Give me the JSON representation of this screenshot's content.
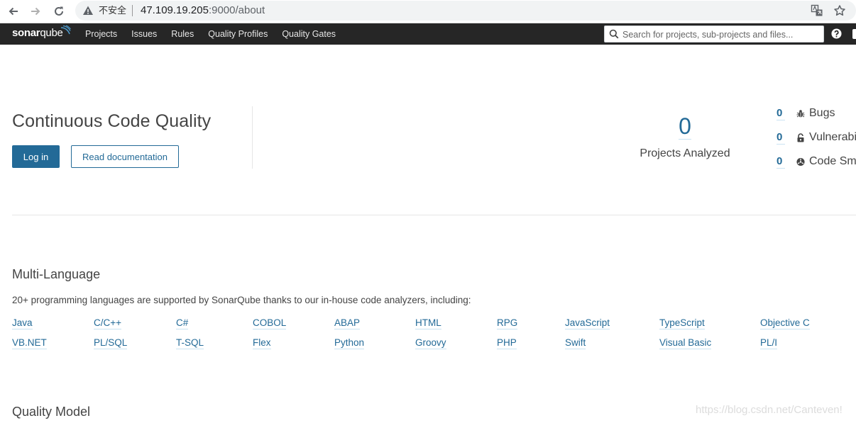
{
  "browser": {
    "security_label": "不安全",
    "url_host": "47.109.19.205",
    "url_path": ":9000/about"
  },
  "nav": {
    "logo_sonar": "sonar",
    "logo_qube": "qube",
    "links": [
      "Projects",
      "Issues",
      "Rules",
      "Quality Profiles",
      "Quality Gates"
    ],
    "search_placeholder": "Search for projects, sub-projects and files..."
  },
  "hero": {
    "title": "Continuous Code Quality",
    "login_label": "Log in",
    "docs_label": "Read documentation",
    "projects_count": "0",
    "projects_label": "Projects Analyzed",
    "metrics": [
      {
        "value": "0",
        "label": "Bugs",
        "icon": "bug-icon"
      },
      {
        "value": "0",
        "label": "Vulnerabilities",
        "icon": "lock-icon"
      },
      {
        "value": "0",
        "label": "Code Smells",
        "icon": "code-smell-icon"
      }
    ]
  },
  "multi_language": {
    "title": "Multi-Language",
    "description": "20+ programming languages are supported by SonarQube thanks to our in-house code analyzers, including:",
    "languages_row1": [
      "Java",
      "C/C++",
      "C#",
      "COBOL",
      "ABAP",
      "HTML",
      "RPG",
      "JavaScript",
      "TypeScript",
      "Objective C"
    ],
    "languages_row2": [
      "VB.NET",
      "PL/SQL",
      "T-SQL",
      "Flex",
      "Python",
      "Groovy",
      "PHP",
      "Swift",
      "Visual Basic",
      "PL/I"
    ]
  },
  "quality_model": {
    "title": "Quality Model"
  },
  "watermark": "https://blog.csdn.net/Canteven!",
  "colors": {
    "accent": "#236a97",
    "nav_bg": "#262626"
  }
}
